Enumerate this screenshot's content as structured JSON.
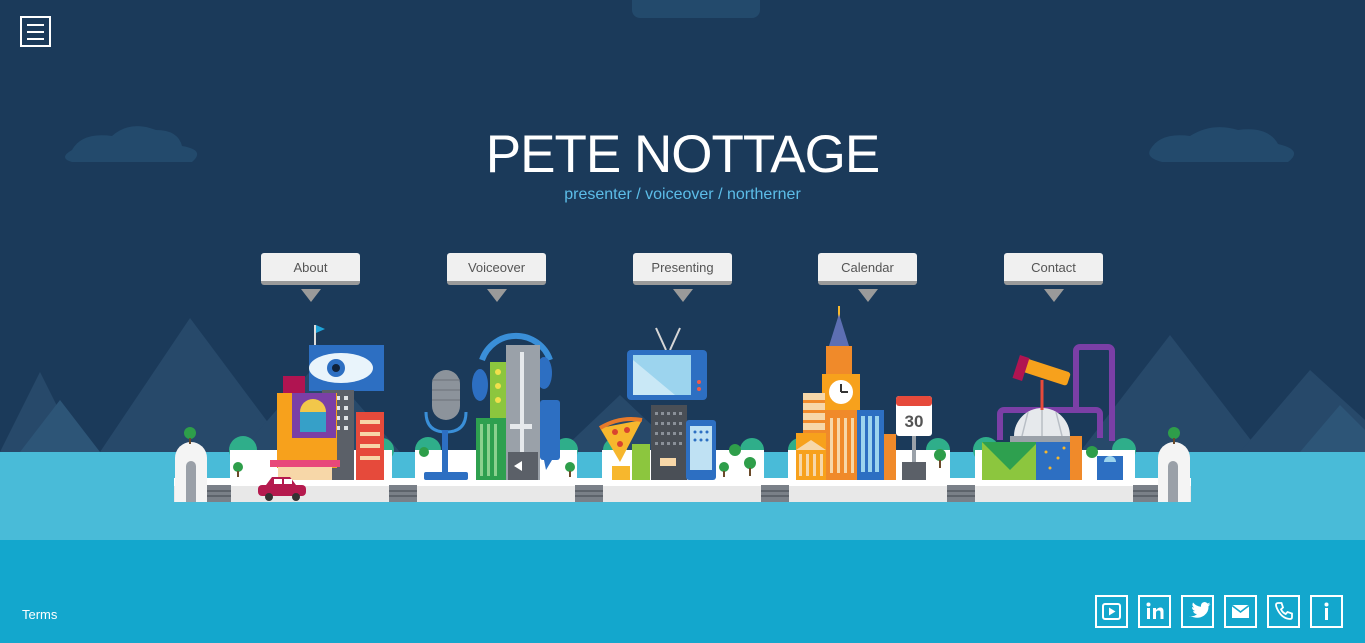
{
  "header": {
    "title": "PETE NOTTAGE",
    "subtitle": "presenter / voiceover / northerner"
  },
  "nav": [
    {
      "label": "About"
    },
    {
      "label": "Voiceover"
    },
    {
      "label": "Presenting"
    },
    {
      "label": "Calendar"
    },
    {
      "label": "Contact"
    }
  ],
  "calendar_day": "30",
  "footer": {
    "terms": "Terms",
    "social_icons": [
      "youtube-icon",
      "linkedin-icon",
      "twitter-icon",
      "email-icon",
      "phone-icon",
      "info-icon"
    ]
  },
  "colors": {
    "sky": "#1b3a5a",
    "accent": "#5cbde8",
    "water": "#49bbd8",
    "footer": "#13a7cd"
  }
}
